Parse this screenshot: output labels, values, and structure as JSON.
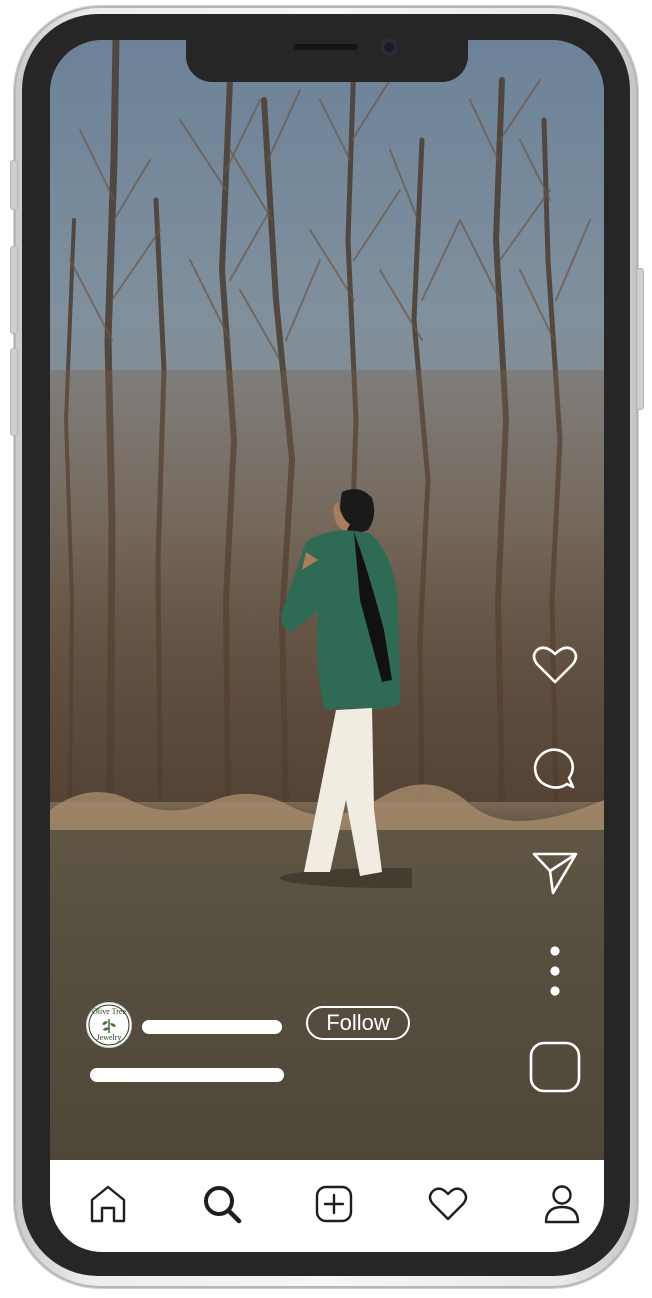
{
  "post": {
    "follow_label": "Follow",
    "avatar_logo_lines": [
      "Olive Tree",
      "Jewelry"
    ]
  },
  "right_rail": {
    "icons": [
      "heart-icon",
      "comment-icon",
      "send-icon",
      "more-options-icon",
      "square-icon"
    ]
  },
  "bottom_nav": {
    "items": [
      "home-icon",
      "search-icon",
      "create-post-icon",
      "activity-heart-icon",
      "profile-icon"
    ]
  },
  "colors": {
    "nav_background": "#ffffff",
    "icon_stroke_on_photo": "#ffffff",
    "icon_stroke_nav": "#1e1e1e",
    "phone_bezel": "#262626"
  }
}
